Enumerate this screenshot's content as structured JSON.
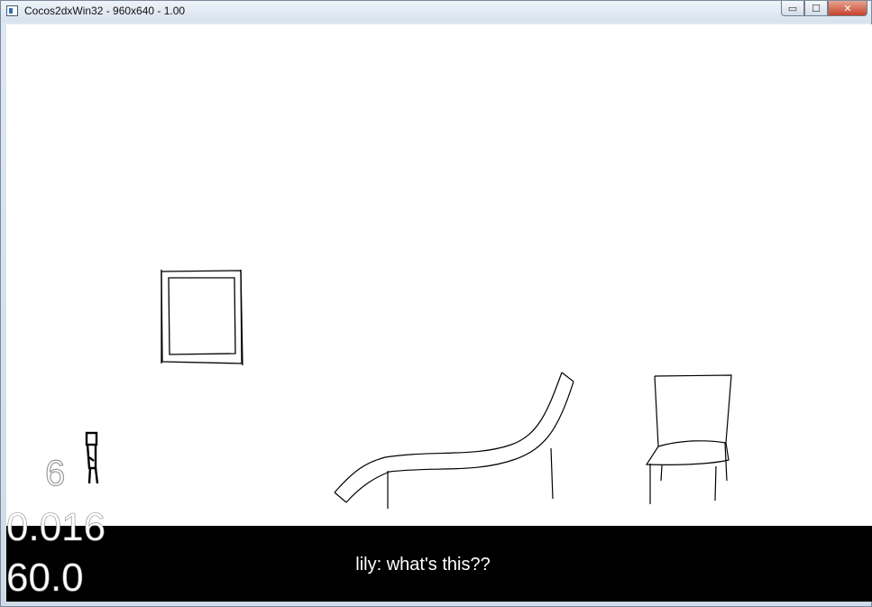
{
  "window": {
    "title": "Cocos2dxWin32 - 960x640 - 1.00",
    "controls": {
      "minimize": "▭",
      "maximize": "☐",
      "close": "✕"
    }
  },
  "game": {
    "lives": "6",
    "dialog": "lily: what's this??",
    "stats": {
      "frame_time": "0.016",
      "fps": "60.0"
    },
    "background_color": "#ffffff",
    "dialog_bar_color": "#000000"
  }
}
